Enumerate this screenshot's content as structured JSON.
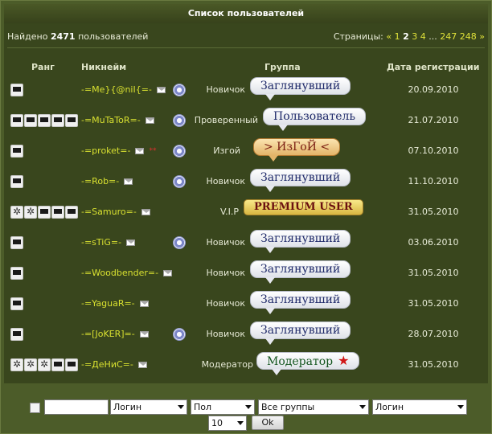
{
  "title": "Список пользователей",
  "found": {
    "prefix": "Найдено",
    "count": "2471",
    "suffix": "пользователей"
  },
  "pages": {
    "label": "Страницы:",
    "prev": "«",
    "p1": "1",
    "current": "2",
    "p3": "3",
    "p4": "4",
    "ellipsis": "...",
    "p247": "247",
    "p248": "248",
    "next": "»"
  },
  "headers": {
    "rank": "Ранг",
    "nick": "Никнейм",
    "group": "Группа",
    "date": "Дата регистрации"
  },
  "users": [
    {
      "nick": "-=Me}{@niI{=-",
      "group": "Новичок",
      "badge": "Заглянувший",
      "date": "20.09.2010"
    },
    {
      "nick": "-=MuTaToR=-",
      "group": "Проверенный",
      "badge": "Пользователь",
      "date": "21.07.2010"
    },
    {
      "nick": "-=proket=-",
      "stars": "**",
      "group": "Изгой",
      "badge": "> ИзГоЙ <",
      "date": "07.10.2010"
    },
    {
      "nick": "-=Rob=-",
      "group": "Новичок",
      "badge": "Заглянувший",
      "date": "11.10.2010"
    },
    {
      "nick": "-=Samuro=-",
      "group": "V.I.P",
      "badge": "PREMIUM USER",
      "date": "31.05.2010"
    },
    {
      "nick": "-=sTiG=-",
      "group": "Новичок",
      "badge": "Заглянувший",
      "date": "03.06.2010"
    },
    {
      "nick": "-=Woodbender=-",
      "group": "Новичок",
      "badge": "Заглянувший",
      "date": "31.05.2010"
    },
    {
      "nick": "-=YaguaR=-",
      "group": "Новичок",
      "badge": "Заглянувший",
      "date": "31.05.2010"
    },
    {
      "nick": "-=[JoKER]=-",
      "group": "Новичок",
      "badge": "Заглянувший",
      "date": "28.07.2010"
    },
    {
      "nick": "-=ДеНиС=-",
      "group": "Модератор",
      "badge": "Модератор",
      "date": "31.05.2010"
    }
  ],
  "filters": {
    "sort1": "Логин",
    "gender": "Пол",
    "groups": "Все группы",
    "sort2": "Логин",
    "perpage": "10",
    "ok": "Ok"
  },
  "icons": {
    "mail": "mail-icon",
    "online": "clock-icon",
    "rank": "rank-icon",
    "star": "star-icon"
  }
}
